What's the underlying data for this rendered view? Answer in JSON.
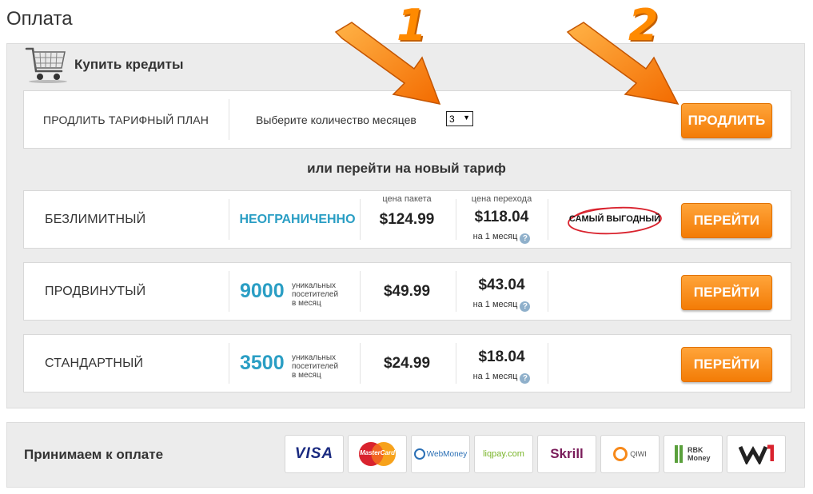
{
  "page": {
    "title": "Оплата"
  },
  "buy": {
    "title": "Купить кредиты"
  },
  "extend": {
    "label": "ПРОДЛИТЬ ТАРИФНЫЙ ПЛАН",
    "months_label": "Выберите количество месяцев",
    "months_value": "3",
    "button": "ПРОДЛИТЬ"
  },
  "or_text": "или перейти на новый тариф",
  "plans": [
    {
      "name": "БЕЗЛИМИТНЫЙ",
      "visitors": "НЕОГРАНИЧЕННО",
      "pkg_caption": "цена пакета",
      "pkg_price": "$124.99",
      "sw_caption": "цена перехода",
      "sw_price": "$118.04",
      "per_month": "на 1 месяц",
      "badge": "САМЫЙ ВЫГОДНЫЙ",
      "button": "ПЕРЕЙТИ"
    },
    {
      "name": "ПРОДВИНУТЫЙ",
      "visitors_num": "9000",
      "visitors_text": [
        "уникальных",
        "посетителей",
        "в месяц"
      ],
      "pkg_price": "$49.99",
      "sw_price": "$43.04",
      "per_month": "на 1 месяц",
      "button": "ПЕРЕЙТИ"
    },
    {
      "name": "СТАНДАРТНЫЙ",
      "visitors_num": "3500",
      "visitors_text": [
        "уникальных",
        "посетителей",
        "в месяц"
      ],
      "pkg_price": "$24.99",
      "sw_price": "$18.04",
      "per_month": "на 1 месяц",
      "button": "ПЕРЕЙТИ"
    }
  ],
  "payment": {
    "label": "Принимаем к оплате",
    "methods": [
      {
        "name": "VISA",
        "icon": "visa-logo"
      },
      {
        "name": "MasterCard",
        "icon": "mastercard-logo"
      },
      {
        "name": "WebMoney",
        "icon": "webmoney-logo"
      },
      {
        "name": "liqpay.com",
        "icon": "liqpay-logo"
      },
      {
        "name": "Skrill",
        "icon": "skrill-logo"
      },
      {
        "name": "QIWI",
        "icon": "qiwi-logo"
      },
      {
        "name": "RBK Money",
        "icon": "rbk-money-logo"
      },
      {
        "name": "W1",
        "icon": "w1-logo"
      }
    ]
  },
  "annotations": {
    "arrow1": "1",
    "arrow2": "2"
  },
  "colors": {
    "accent_orange": "#f7891a",
    "link_blue": "#2a9ec4",
    "panel_bg": "#ececec",
    "badge_ring": "#d9232e"
  }
}
